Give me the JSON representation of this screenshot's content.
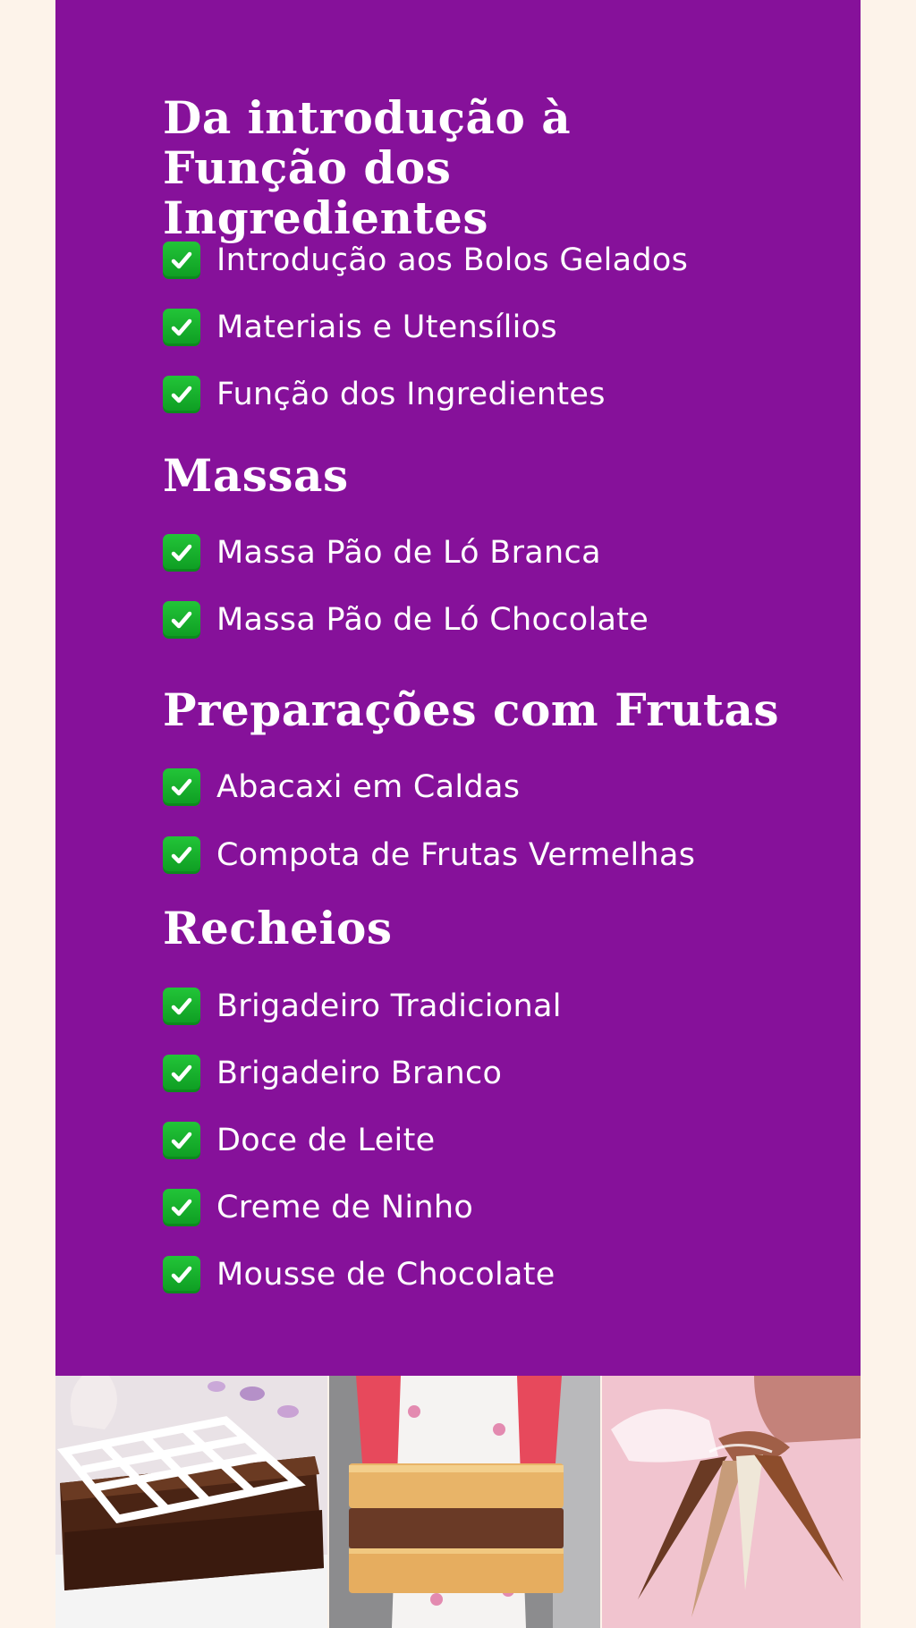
{
  "sections": [
    {
      "title": "Da introdução à Função dos Ingredientes",
      "items": [
        "Introdução aos Bolos Gelados",
        "Materiais e Utensílios",
        "Função dos Ingredientes"
      ]
    },
    {
      "title": "Massas",
      "items": [
        "Massa Pão de Ló Branca",
        "Massa Pão de Ló Chocolate"
      ]
    },
    {
      "title": "Preparações com Frutas",
      "items": [
        "Abacaxi em Caldas",
        "Compota de Frutas Vermelhas"
      ]
    },
    {
      "title": "Recheios",
      "items": [
        "Brigadeiro Tradicional",
        "Brigadeiro Branco",
        "Doce de Leite",
        "Creme de Ninho",
        "Mousse de Chocolate"
      ]
    }
  ],
  "icons": {
    "item_marker": "check-mark-button-icon"
  },
  "colors": {
    "background": "#fdf3ea",
    "panel": "#86119a",
    "text": "#ffffff",
    "check": "#16b02c"
  }
}
